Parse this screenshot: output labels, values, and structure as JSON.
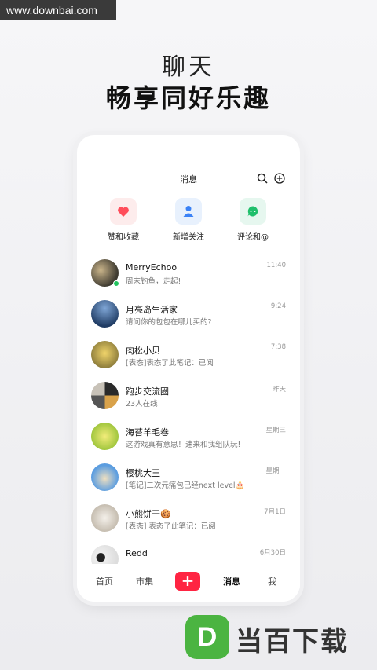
{
  "watermark": "www.downbai.com",
  "hero": {
    "subtitle": "聊天",
    "title": "畅享同好乐趣"
  },
  "phone": {
    "title": "消息",
    "quick_actions": [
      {
        "label": "赞和收藏",
        "icon": "heart-icon",
        "bg": "#fdecec",
        "color": "#ff4d5a"
      },
      {
        "label": "新增关注",
        "icon": "person-icon",
        "bg": "#e8f1fd",
        "color": "#3b82f6"
      },
      {
        "label": "评论和@",
        "icon": "chat-bubble-icon",
        "bg": "#e6f7ef",
        "color": "#1fbf6b"
      }
    ],
    "messages": [
      {
        "name": "MerryEchoo",
        "preview": "周末钓鱼，走起!",
        "time": "11:40",
        "online": true,
        "avatar_color": "#4a4a3a"
      },
      {
        "name": "月亮岛生活家",
        "preview": "请问你的包包在哪儿买的?",
        "time": "9:24",
        "online": false,
        "avatar_color": "#2f5a8a"
      },
      {
        "name": "肉松小贝",
        "preview": "[表态]表态了此笔记：已阅",
        "time": "7:38",
        "online": false,
        "avatar_color": "#d6b84a"
      },
      {
        "name": "跑步交流圈",
        "preview": "23人在线",
        "time": "昨天",
        "online": false,
        "avatar_color": "#3a3a3a"
      },
      {
        "name": "海苔羊毛卷",
        "preview": "这游戏真有意思！速来和我组队玩!",
        "time": "星期三",
        "online": false,
        "avatar_color": "#b9d94a"
      },
      {
        "name": "樱桃大王",
        "preview": "[笔记]二次元痛包已经next level🎂",
        "time": "星期一",
        "online": false,
        "avatar_color": "#5b9de0"
      },
      {
        "name": "小熊饼干🍪",
        "preview": "[表态] 表态了此笔记：已阅",
        "time": "7月1日",
        "online": false,
        "avatar_color": "#d8d2c8"
      },
      {
        "name": "Redd",
        "preview": "",
        "time": "6月30日",
        "online": false,
        "avatar_color": "#e8e8e8"
      }
    ],
    "tabs": [
      {
        "label": "首页",
        "active": false
      },
      {
        "label": "市集",
        "active": false
      },
      {
        "label": "+",
        "active": false
      },
      {
        "label": "消息",
        "active": true
      },
      {
        "label": "我",
        "active": false
      }
    ]
  },
  "brand": {
    "letter": "D",
    "text": "当百下载",
    "color": "#4bb441"
  }
}
